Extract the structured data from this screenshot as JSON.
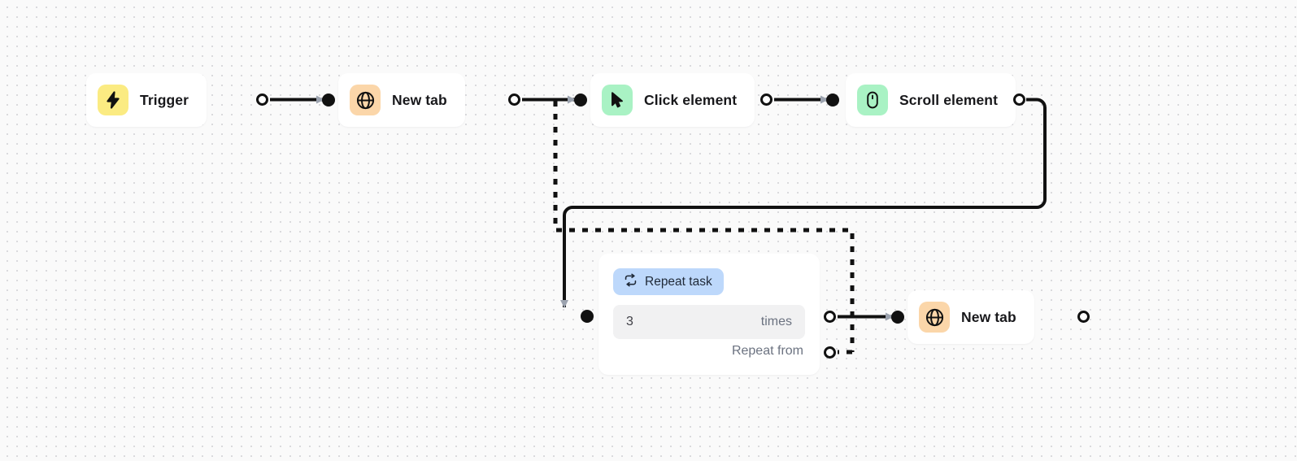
{
  "canvas": {
    "background_color": "#fafafa",
    "grid_dot_color": "#d4d4d8"
  },
  "nodes": [
    {
      "id": "trigger",
      "label": "Trigger",
      "icon": "lightning-bolt-icon",
      "tile_color": "#fbeb82"
    },
    {
      "id": "new-tab-1",
      "label": "New tab",
      "icon": "globe-icon",
      "tile_color": "#fbd6a9"
    },
    {
      "id": "click-element",
      "label": "Click element",
      "icon": "cursor-pointer-icon",
      "tile_color": "#a9f2c4"
    },
    {
      "id": "scroll-element",
      "label": "Scroll element",
      "icon": "mouse-icon",
      "tile_color": "#a9f2c4"
    },
    {
      "id": "new-tab-2",
      "label": "New tab",
      "icon": "globe-icon",
      "tile_color": "#fbd6a9"
    }
  ],
  "repeat_task": {
    "badge_label": "Repeat task",
    "badge_icon": "repeat-loop-icon",
    "badge_color": "#bdd8fb",
    "count_value": "3",
    "count_unit": "times",
    "repeat_from_label": "Repeat from"
  },
  "edge_styles": {
    "solid_color": "#111111",
    "dashed_color": "#111111",
    "arrow_color": "#9ca3af"
  }
}
